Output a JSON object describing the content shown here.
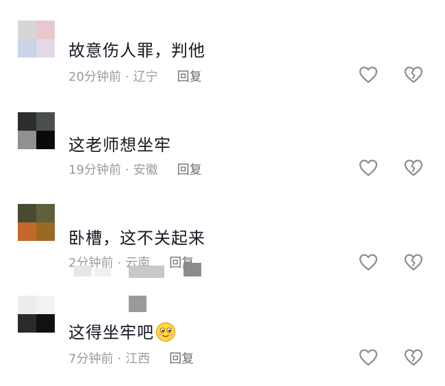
{
  "comments": [
    {
      "text": "故意伤人罪，判他",
      "time": "20分钟前",
      "location": "辽宁",
      "reply": "回复",
      "avatar": [
        "#d6d6d6",
        "#e8c7cf",
        "#c9d4e6",
        "#e2d8e6"
      ]
    },
    {
      "text": "这老师想坐牢",
      "time": "19分钟前",
      "location": "安徽",
      "reply": "回复",
      "avatar": [
        "#2c2f2b",
        "#4b4f4c",
        "#8e9190",
        "#0a0a0a"
      ]
    },
    {
      "text": "卧槽，这不关起来",
      "time": "2分钟前",
      "location": "云南",
      "reply": "回复",
      "avatar": [
        "#4a4a33",
        "#5f5f3e",
        "#c4682a",
        "#9a6a24"
      ]
    },
    {
      "text": "这得坐牢吧",
      "emoji": "smiling-face-emoji",
      "time": "7分钟前",
      "location": "江西",
      "reply": "回复",
      "avatar": [
        "#ededed",
        "#f5f0f3",
        "#2b2b2b",
        "#111111"
      ]
    }
  ],
  "separator": "·",
  "icons": {
    "like": "heart-outline-icon",
    "dislike": "broken-heart-outline-icon"
  },
  "colors": {
    "text": "#161823",
    "meta": "#9a9ba0",
    "reply": "#6b6c72",
    "icon": "#8a8b90"
  }
}
